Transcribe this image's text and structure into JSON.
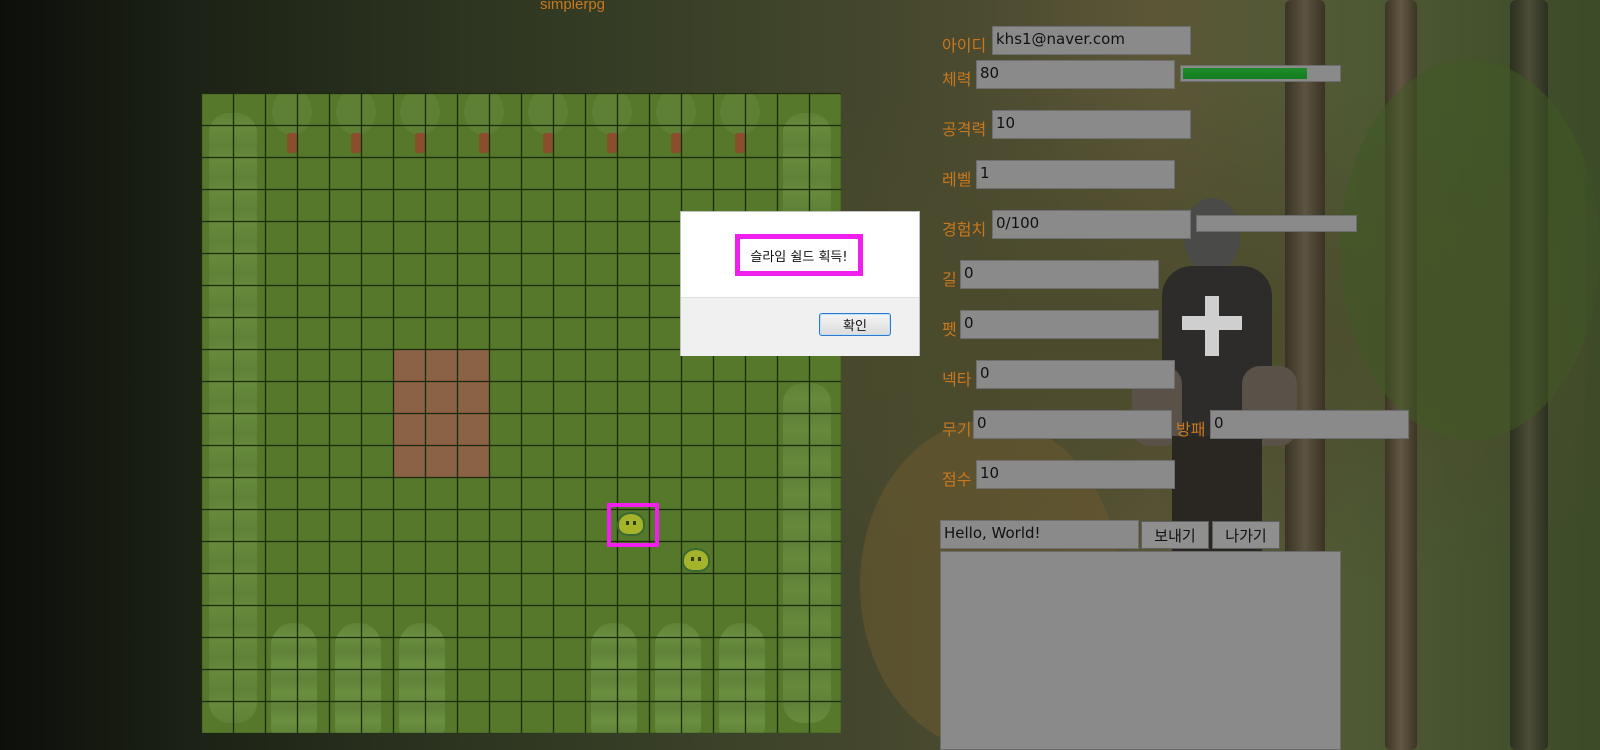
{
  "page": {
    "title": "simplerpg"
  },
  "game": {
    "grid_cols": 20,
    "grid_rows": 20,
    "slimes": [
      {
        "name": "highlighted-slime",
        "col": 13,
        "row": 13.5
      },
      {
        "name": "slime",
        "col": 15,
        "row": 14.6
      }
    ]
  },
  "dialog": {
    "message": "슬라임 쉴드 획득!",
    "ok_label": "확인"
  },
  "stats": {
    "id_label": "아이디",
    "id_value": "khs1@naver.com",
    "hp_label": "체력",
    "hp_value": "80",
    "hp_fraction": 0.8,
    "attack_label": "공격력",
    "attack_value": "10",
    "level_label": "레벨",
    "level_value": "1",
    "exp_label": "경험치",
    "exp_value": "0/100",
    "exp_fraction": 0,
    "gold_label": "길",
    "gold_value": "0",
    "pet_label": "펫",
    "pet_value": "0",
    "nectar_label": "넥타",
    "nectar_value": "0",
    "weapon_label": "무기",
    "weapon_value": "0",
    "armor_label": "방패",
    "armor_value": "0",
    "score_label": "점수",
    "score_value": "10"
  },
  "chat": {
    "input_value": "Hello, World!",
    "send_label": "보내기",
    "exit_label": "나가기",
    "log": ""
  },
  "colors": {
    "label": "#c8781e",
    "grass": "#55782b",
    "highlight": "#f01fee",
    "hp_bar": "#1f8a2a"
  }
}
